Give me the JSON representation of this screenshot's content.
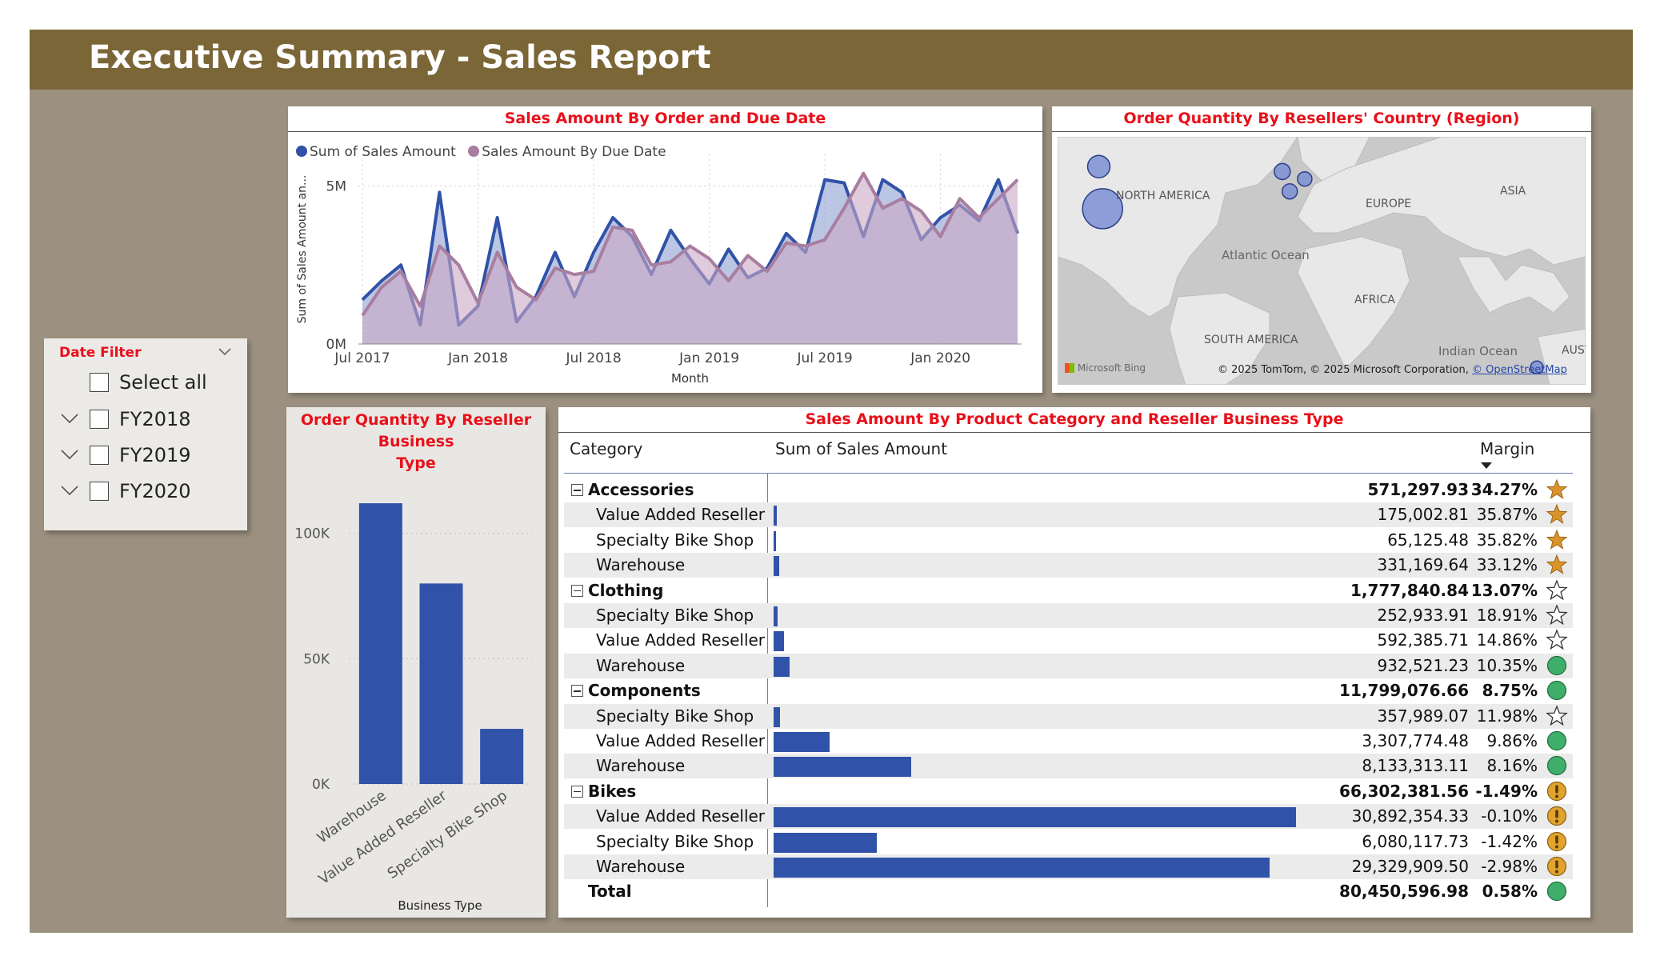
{
  "header": {
    "title": "Executive Summary - Sales Report"
  },
  "line_panel": {
    "title": "Sales Amount By Order and Due Date",
    "legend": [
      "Sum of Sales Amount",
      "Sales Amount By Due Date"
    ],
    "colors": {
      "order": "#3052a8",
      "due": "#a87ea0"
    }
  },
  "map_panel": {
    "title": "Order Quantity By Resellers' Country (Region)",
    "labels": {
      "na": "NORTH AMERICA",
      "europe": "EUROPE",
      "asia": "ASIA",
      "atlantic": "Atlantic Ocean",
      "africa": "AFRICA",
      "sa": "SOUTH AMERICA",
      "indian": "Indian Ocean",
      "aust": "AUST"
    },
    "bing": "Microsoft Bing",
    "copyright": "© 2025 TomTom, © 2025 Microsoft Corporation,",
    "osm": "© OpenStreetMap"
  },
  "slicer": {
    "title": "Date Filter",
    "items": [
      "Select all",
      "FY2018",
      "FY2019",
      "FY2020"
    ]
  },
  "bar_panel": {
    "title_lines": [
      "Order Quantity By Reseller",
      "Business",
      "Type"
    ]
  },
  "matrix": {
    "title": "Sales Amount By Product Category and Reseller Business Type",
    "columns": {
      "category": "Category",
      "amount": "Sum of Sales Amount",
      "margin": "Margin"
    },
    "rows": [
      {
        "level": 0,
        "label": "Accessories",
        "amount": "571,297.93",
        "value": 571297.93,
        "margin": "34.27%",
        "icon": "star-filled"
      },
      {
        "level": 1,
        "label": "Value Added Reseller",
        "amount": "175,002.81",
        "value": 175002.81,
        "margin": "35.87%",
        "icon": "star-filled"
      },
      {
        "level": 1,
        "label": "Specialty Bike Shop",
        "amount": "65,125.48",
        "value": 65125.48,
        "margin": "35.82%",
        "icon": "star-filled"
      },
      {
        "level": 1,
        "label": "Warehouse",
        "amount": "331,169.64",
        "value": 331169.64,
        "margin": "33.12%",
        "icon": "star-filled"
      },
      {
        "level": 0,
        "label": "Clothing",
        "amount": "1,777,840.84",
        "value": 1777840.84,
        "margin": "13.07%",
        "icon": "star-empty"
      },
      {
        "level": 1,
        "label": "Specialty Bike Shop",
        "amount": "252,933.91",
        "value": 252933.91,
        "margin": "18.91%",
        "icon": "star-empty"
      },
      {
        "level": 1,
        "label": "Value Added Reseller",
        "amount": "592,385.71",
        "value": 592385.71,
        "margin": "14.86%",
        "icon": "star-empty"
      },
      {
        "level": 1,
        "label": "Warehouse",
        "amount": "932,521.23",
        "value": 932521.23,
        "margin": "10.35%",
        "icon": "circle-green"
      },
      {
        "level": 0,
        "label": "Components",
        "amount": "11,799,076.66",
        "value": 11799076.66,
        "margin": "8.75%",
        "icon": "circle-green"
      },
      {
        "level": 1,
        "label": "Specialty Bike Shop",
        "amount": "357,989.07",
        "value": 357989.07,
        "margin": "11.98%",
        "icon": "star-empty"
      },
      {
        "level": 1,
        "label": "Value Added Reseller",
        "amount": "3,307,774.48",
        "value": 3307774.48,
        "margin": "9.86%",
        "icon": "circle-green"
      },
      {
        "level": 1,
        "label": "Warehouse",
        "amount": "8,133,313.11",
        "value": 8133313.11,
        "margin": "8.16%",
        "icon": "circle-green"
      },
      {
        "level": 0,
        "label": "Bikes",
        "amount": "66,302,381.56",
        "value": 66302381.56,
        "margin": "-1.49%",
        "icon": "warning-amber"
      },
      {
        "level": 1,
        "label": "Value Added Reseller",
        "amount": "30,892,354.33",
        "value": 30892354.33,
        "margin": "-0.10%",
        "icon": "warning-amber"
      },
      {
        "level": 1,
        "label": "Specialty Bike Shop",
        "amount": "6,080,117.73",
        "value": 6080117.73,
        "margin": "-1.42%",
        "icon": "warning-amber"
      },
      {
        "level": 1,
        "label": "Warehouse",
        "amount": "29,329,909.50",
        "value": 29329909.5,
        "margin": "-2.98%",
        "icon": "warning-amber"
      },
      {
        "level": 2,
        "label": "Total",
        "amount": "80,450,596.98",
        "value": 80450596.98,
        "margin": "0.58%",
        "icon": "circle-green"
      }
    ],
    "colors": {
      "bar": "#3052a8",
      "star": "#d9942c",
      "green": "#3fae6a",
      "amber": "#e0a42e"
    }
  },
  "chart_data": [
    {
      "type": "area",
      "title": "Sales Amount By Order and Due Date",
      "xlabel": "Month",
      "ylabel": "Sum of Sales Amount an...",
      "x_ticks": [
        "Jul 2017",
        "Jan 2018",
        "Jul 2018",
        "Jan 2019",
        "Jul 2019",
        "Jan 2020"
      ],
      "y_ticks": [
        "0M",
        "5M"
      ],
      "ylim": [
        0,
        6000000
      ],
      "x_start": "2017-07",
      "series": [
        {
          "name": "Sum of Sales Amount",
          "values": [
            1400000,
            2000000,
            2500000,
            600000,
            4800000,
            600000,
            1200000,
            4000000,
            700000,
            1500000,
            2900000,
            1500000,
            2900000,
            4000000,
            3400000,
            2200000,
            3600000,
            2700000,
            1900000,
            3000000,
            2100000,
            2400000,
            3500000,
            2900000,
            5200000,
            5100000,
            3400000,
            5200000,
            4800000,
            3300000,
            4000000,
            4400000,
            3900000,
            5200000,
            3500000
          ]
        },
        {
          "name": "Sales Amount By Due Date",
          "values": [
            900000,
            1800000,
            2300000,
            1200000,
            3100000,
            2500000,
            1300000,
            2900000,
            1800000,
            1400000,
            2400000,
            2200000,
            2300000,
            3700000,
            3600000,
            2500000,
            2600000,
            3100000,
            2700000,
            2000000,
            2800000,
            2300000,
            3200000,
            3100000,
            3300000,
            4300000,
            5400000,
            4300000,
            4600000,
            4200000,
            3400000,
            4600000,
            4000000,
            4600000,
            5200000
          ]
        }
      ]
    },
    {
      "type": "bar",
      "xlabel": "Business Type",
      "categories": [
        "Warehouse",
        "Value Added Reseller",
        "Specialty Bike Shop"
      ],
      "values": [
        112000,
        80000,
        22000
      ],
      "y_ticks": [
        "0K",
        "50K",
        "100K"
      ],
      "ylim": [
        0,
        120000
      ]
    },
    {
      "type": "scatter",
      "title": "Order Quantity By Resellers' Country (Region)",
      "points": [
        {
          "region": "Canada",
          "lon": -100,
          "lat": 56,
          "size": 16
        },
        {
          "region": "United States",
          "lon": -98,
          "lat": 39,
          "size": 38
        },
        {
          "region": "United Kingdom",
          "lon": -2,
          "lat": 54,
          "size": 8
        },
        {
          "region": "Germany",
          "lon": 10,
          "lat": 51,
          "size": 6
        },
        {
          "region": "France",
          "lon": 2,
          "lat": 46,
          "size": 7
        },
        {
          "region": "Australia",
          "lon": 134,
          "lat": -25,
          "size": 4
        }
      ]
    }
  ]
}
